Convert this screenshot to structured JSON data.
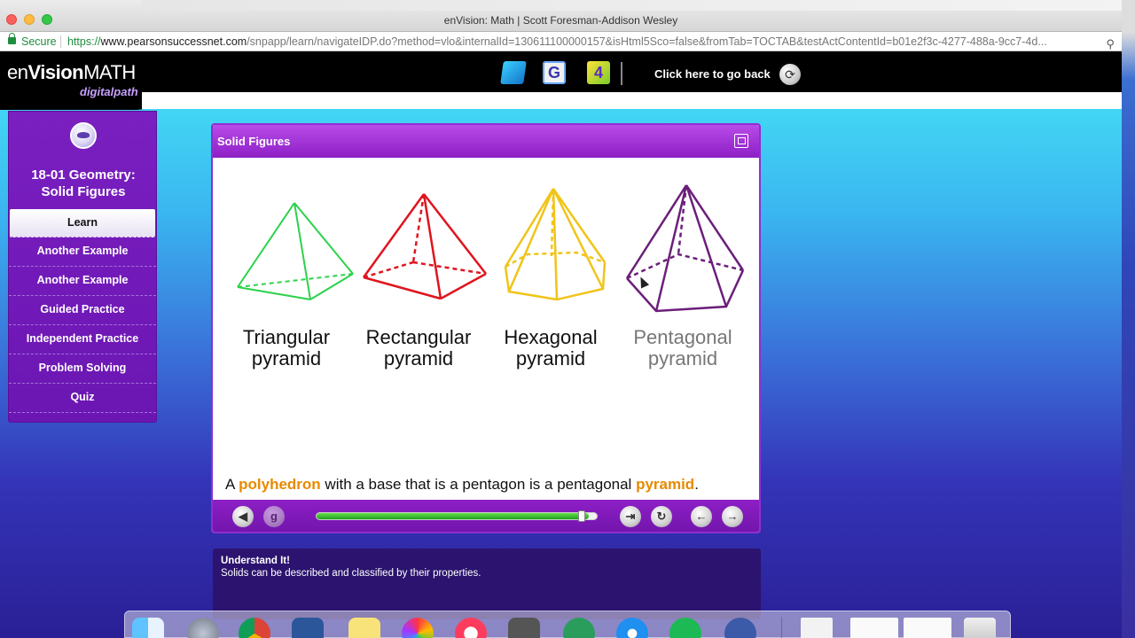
{
  "browser": {
    "window_title": "enVision: Math | Scott Foresman-Addison Wesley",
    "secure_label": "Secure",
    "url_proto": "https://",
    "url_host": "www.pearsonsuccessnet.com",
    "url_path": "/snpapp/learn/navigateIDP.do?method=vlo&internalId=130611100000157&isHtml5Sco=false&fromTab=TOCTAB&testActContentId=b01e2f3c-4277-488a-9cc7-4d..."
  },
  "header": {
    "logo_en": "en",
    "logo_vision": "Vision",
    "logo_math": "MATH",
    "logo_sub": "digitalpath",
    "tool2_label": "G",
    "tool3_label": "4",
    "go_back_label": "Click here to go back"
  },
  "sidebar": {
    "lesson_title_line1": "18-01 Geometry:",
    "lesson_title_line2": "Solid Figures",
    "items": [
      {
        "label": "Learn",
        "active": true
      },
      {
        "label": "Another Example"
      },
      {
        "label": "Another Example"
      },
      {
        "label": "Guided Practice"
      },
      {
        "label": "Independent Practice"
      },
      {
        "label": "Problem Solving"
      },
      {
        "label": "Quiz"
      }
    ]
  },
  "panel": {
    "title": "Solid Figures",
    "figures": [
      {
        "line1": "Triangular",
        "line2": "pyramid",
        "color": "#2bd24a"
      },
      {
        "line1": "Rectangular",
        "line2": "pyramid",
        "color": "#e0141e"
      },
      {
        "line1": "Hexagonal",
        "line2": "pyramid",
        "color": "#f0c419"
      },
      {
        "line1": "Pentagonal",
        "line2": "pyramid",
        "color": "#6b1f7a"
      }
    ],
    "caption_pre": "A ",
    "caption_hl1": "polyhedron",
    "caption_mid": " with a base that is a pentagon is a pentagonal ",
    "caption_hl2": "pyramid",
    "caption_post": ".",
    "progress": 0.97,
    "controls": {
      "back": "◀",
      "glossary": "g",
      "exit": "⇥",
      "replay": "↻",
      "prev": "←",
      "next": "→"
    }
  },
  "notes": {
    "heading": "Understand It!",
    "body": "Solids can be described and classified by their properties."
  },
  "colors": {
    "accent_purple": "#8d1fc6",
    "highlight_orange": "#e68a00"
  }
}
